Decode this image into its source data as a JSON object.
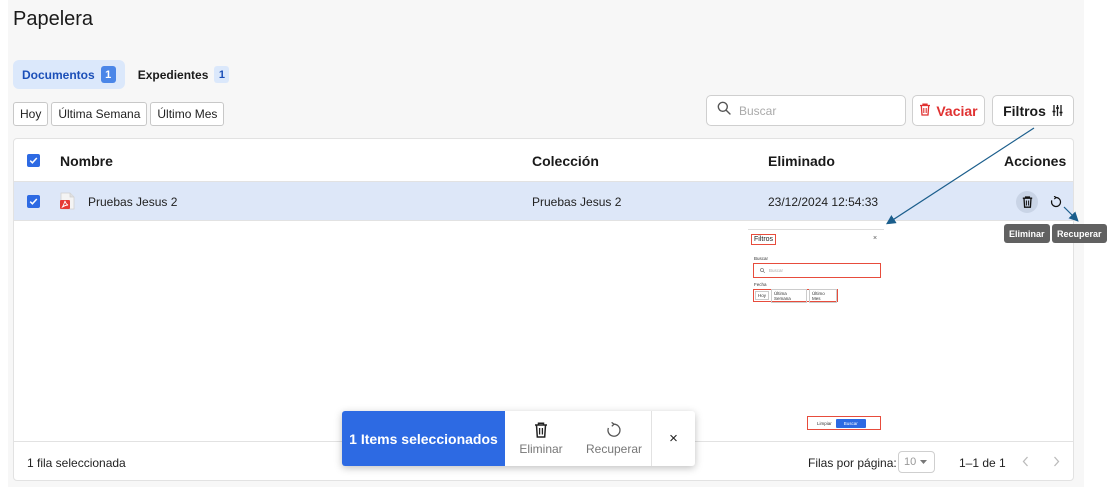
{
  "page": {
    "title": "Papelera"
  },
  "tabs": [
    {
      "label": "Documentos",
      "count": "1",
      "active": true
    },
    {
      "label": "Expedientes",
      "count": "1",
      "active": false
    }
  ],
  "date_filters": [
    "Hoy",
    "Última Semana",
    "Último Mes"
  ],
  "toolbar": {
    "search_placeholder": "Buscar",
    "vaciar_label": "Vaciar",
    "filtros_label": "Filtros"
  },
  "table": {
    "columns": {
      "name": "Nombre",
      "collection": "Colección",
      "deleted": "Eliminado",
      "actions": "Acciones"
    },
    "rows": [
      {
        "name": "Pruebas Jesus 2",
        "collection": "Pruebas Jesus 2",
        "deleted": "23/12/2024 12:54:33",
        "selected": true,
        "file_type": "pdf"
      }
    ],
    "tooltips": {
      "delete": "Eliminar",
      "recover": "Recuperar"
    }
  },
  "footer": {
    "selected_text": "1 fila seleccionada",
    "rows_per_page_label": "Filas por página:",
    "rows_per_page_value": "10",
    "range_text": "1–1 de 1"
  },
  "filter_preview": {
    "title": "Filtros",
    "close": "×",
    "search_label": "Buscar",
    "search_placeholder": "Buscar",
    "date_label": "Fecha",
    "chips": [
      "Hoy",
      "Última Semana",
      "Último Mes"
    ],
    "clear_label": "Limpiar",
    "search_button": "Buscar"
  },
  "snackbar": {
    "count_label": "1 Items seleccionados",
    "delete_label": "Eliminar",
    "recover_label": "Recuperar",
    "close": "×"
  },
  "colors": {
    "primary": "#2d6ae3",
    "danger": "#e03131",
    "selected_row": "#dde7f8",
    "annotation": "#1b5e8c"
  }
}
